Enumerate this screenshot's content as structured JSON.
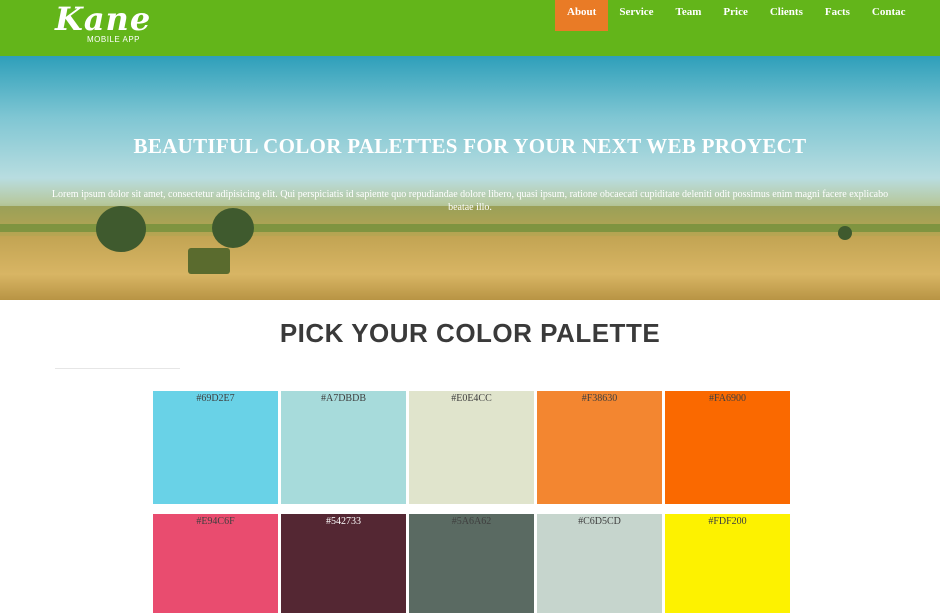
{
  "header": {
    "logo": "Kane",
    "logo_sub": "MOBILE APP",
    "nav": [
      {
        "label": "About",
        "active": true
      },
      {
        "label": "Service",
        "active": false
      },
      {
        "label": "Team",
        "active": false
      },
      {
        "label": "Price",
        "active": false
      },
      {
        "label": "Clients",
        "active": false
      },
      {
        "label": "Facts",
        "active": false
      },
      {
        "label": "Contac",
        "active": false
      }
    ]
  },
  "hero": {
    "title": "BEAUTIFUL COLOR PALETTES FOR YOUR NEXT WEB PROYECT",
    "text": "Lorem ipsum dolor sit amet, consectetur adipisicing elit. Qui perspiciatis id sapiente quo repudiandae dolore libero, quasi ipsum, ratione obcaecati cupiditate deleniti odit possimus enim magni facere explicabo beatae illo."
  },
  "section": {
    "title": "PICK YOUR COLOR PALETTE"
  },
  "palette": [
    {
      "label": "#69D2E7",
      "color": "#69D2E7",
      "dark": false
    },
    {
      "label": "#A7DBDB",
      "color": "#A7DBDB",
      "dark": false
    },
    {
      "label": "#E0E4CC",
      "color": "#E0E4CC",
      "dark": false
    },
    {
      "label": "#F38630",
      "color": "#F38630",
      "dark": false
    },
    {
      "label": "#FA6900",
      "color": "#FA6900",
      "dark": false
    },
    {
      "label": "#E94C6F",
      "color": "#E94C6F",
      "dark": false
    },
    {
      "label": "#542733",
      "color": "#542733",
      "dark": true
    },
    {
      "label": "#5A6A62",
      "color": "#5A6A62",
      "dark": false
    },
    {
      "label": "#C6D5CD",
      "color": "#C6D5CD",
      "dark": false
    },
    {
      "label": "#FDF200",
      "color": "#FDF200",
      "dark": false
    }
  ],
  "colors": {
    "header_bg": "#63b51a",
    "nav_active": "#e97b26"
  }
}
